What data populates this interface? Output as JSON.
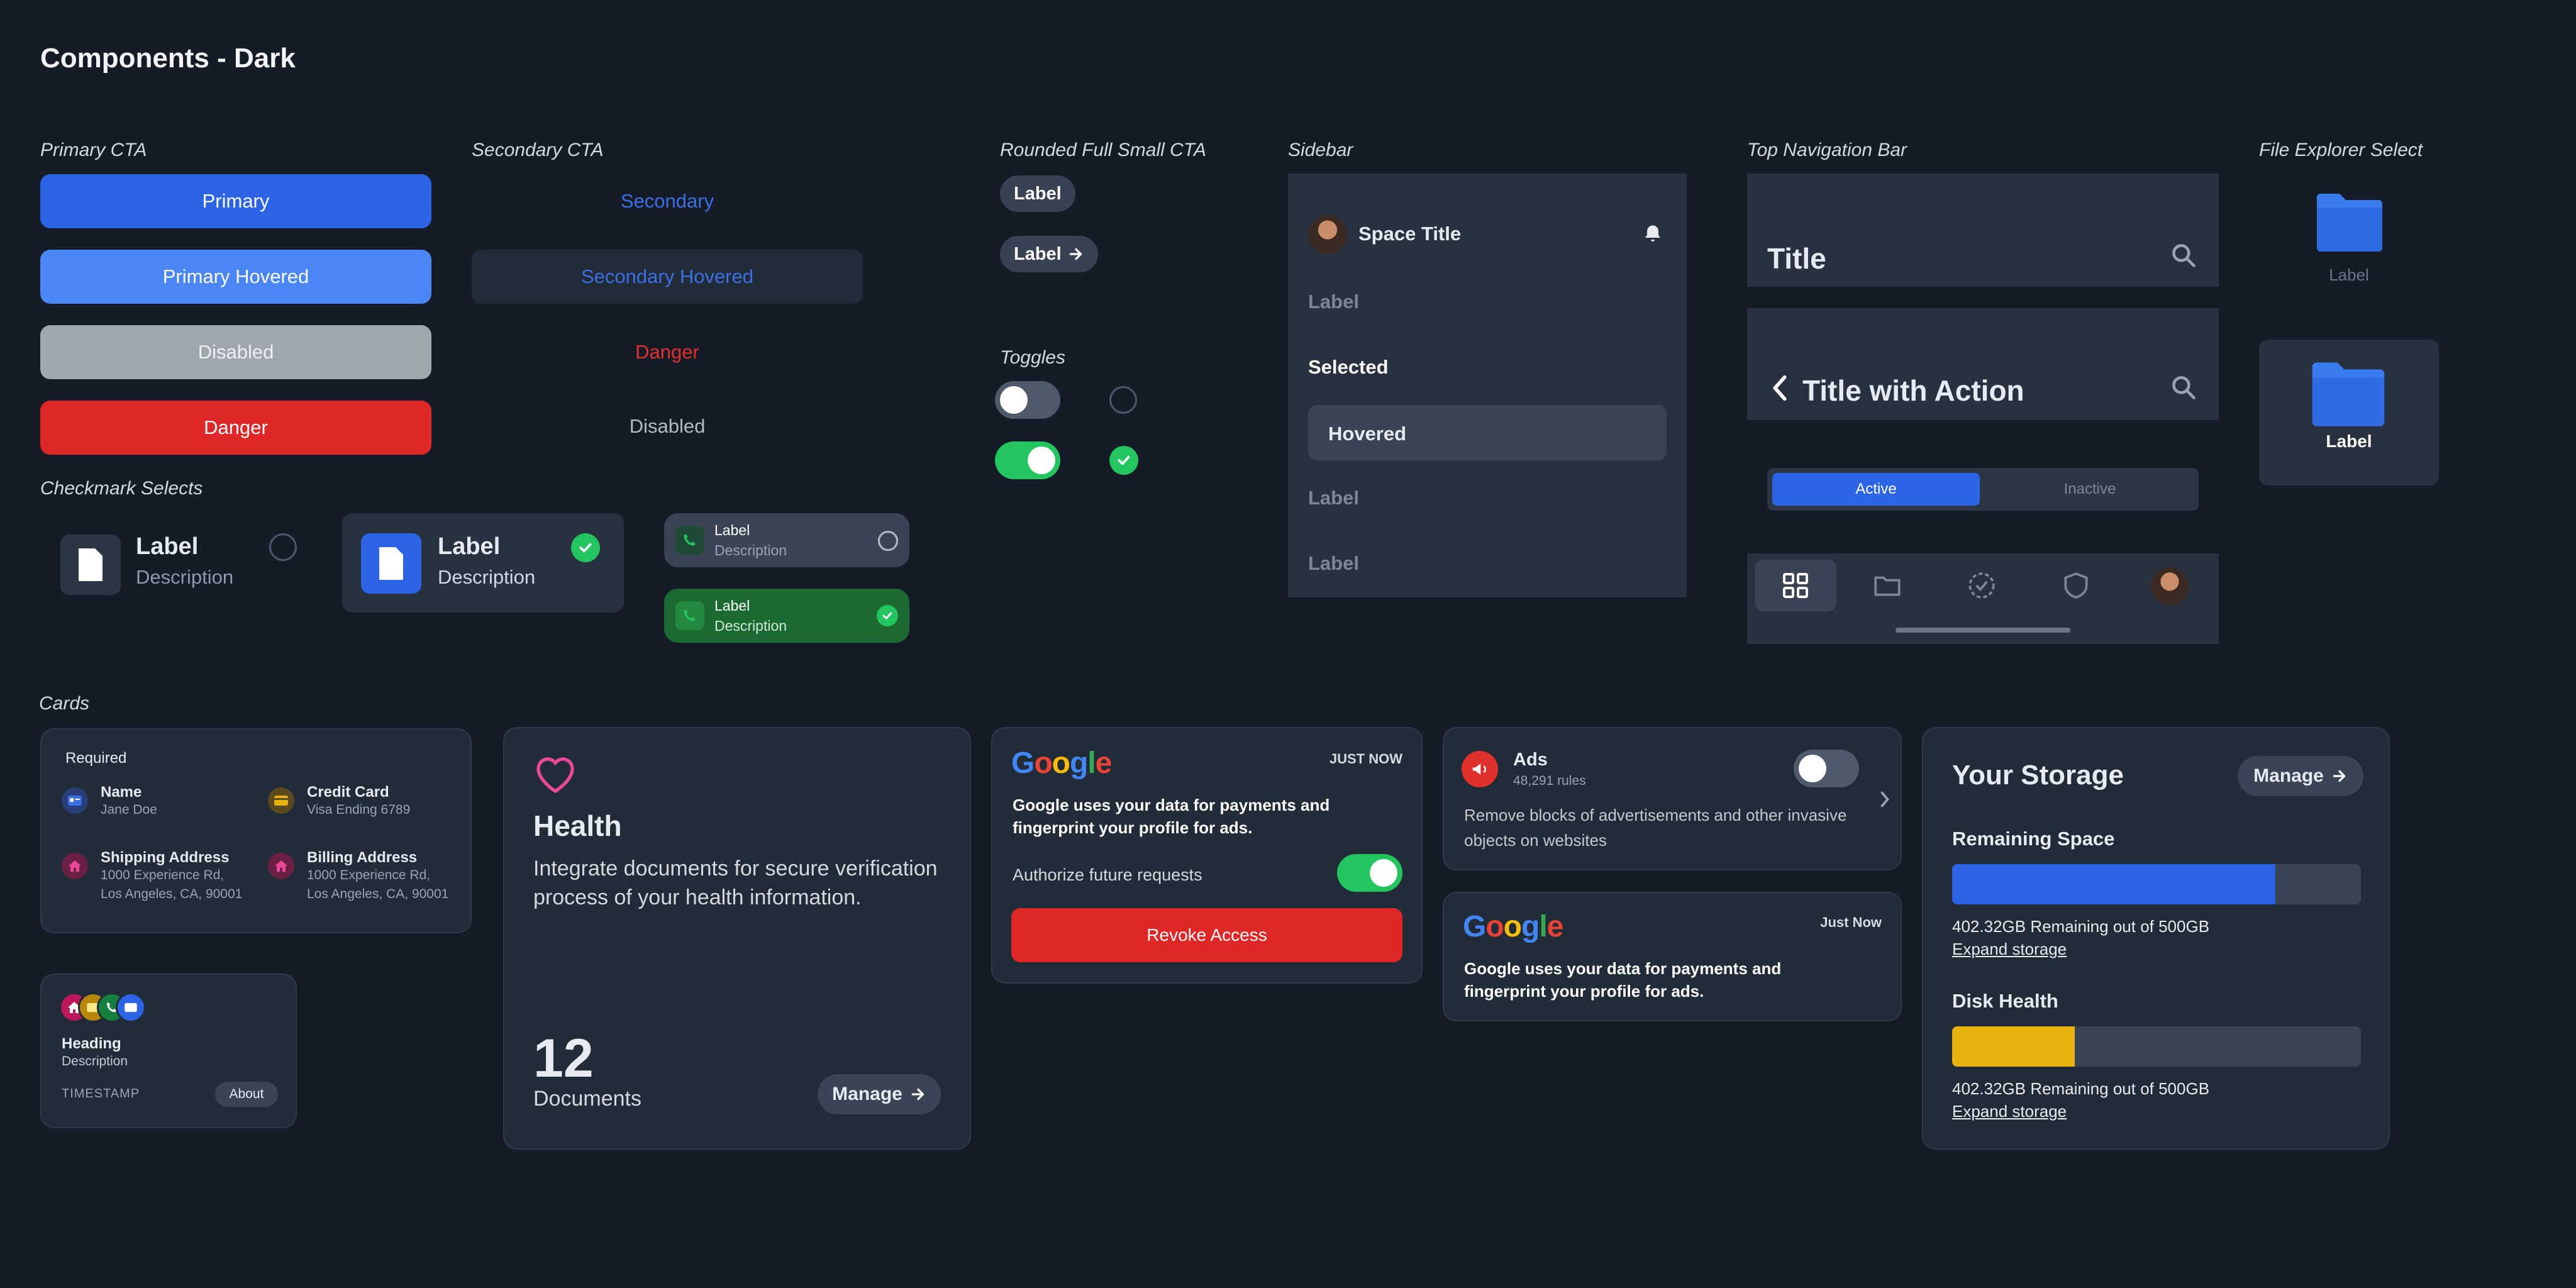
{
  "page_title": "Components - Dark",
  "sections": {
    "primary_cta": "Primary CTA",
    "secondary_cta": "Secondary CTA",
    "rounded_cta": "Rounded Full Small CTA",
    "sidebar": "Sidebar",
    "topnav": "Top Navigation Bar",
    "file_explorer": "File Explorer Select",
    "toggles": "Toggles",
    "checkmark": "Checkmark Selects",
    "cards": "Cards"
  },
  "primary_buttons": {
    "primary": "Primary",
    "primary_hovered": "Primary Hovered",
    "disabled": "Disabled",
    "danger": "Danger"
  },
  "secondary_buttons": {
    "secondary": "Secondary",
    "secondary_hovered": "Secondary Hovered",
    "danger": "Danger",
    "disabled": "Disabled"
  },
  "rounded": {
    "label1": "Label",
    "label2": "Label"
  },
  "sidebar": {
    "space_title": "Space Title",
    "items": [
      "Label",
      "Selected",
      "Hovered",
      "Label",
      "Label"
    ]
  },
  "topnav": {
    "title": "Title",
    "title_action": "Title with Action",
    "seg_active": "Active",
    "seg_inactive": "Inactive"
  },
  "file_explorer": {
    "label1": "Label",
    "label2": "Label"
  },
  "checkmark": {
    "a_label": "Label",
    "a_desc": "Description",
    "b_label": "Label",
    "b_desc": "Description",
    "c_label": "Label",
    "c_desc": "Description",
    "d_label": "Label",
    "d_desc": "Description"
  },
  "card_required": {
    "heading": "Required",
    "name_title": "Name",
    "name_value": "Jane Doe",
    "cc_title": "Credit Card",
    "cc_value": "Visa Ending 6789",
    "ship_title": "Shipping Address",
    "ship_line1": "1000 Experience Rd,",
    "ship_line2": "Los Angeles, CA, 90001",
    "bill_title": "Billing Address",
    "bill_line1": "1000 Experience Rd,",
    "bill_line2": "Los Angeles, CA, 90001"
  },
  "card_small": {
    "heading": "Heading",
    "description": "Description",
    "timestamp": "TIMESTAMP",
    "about": "About"
  },
  "card_health": {
    "title": "Health",
    "text": "Integrate documents for secure verification process of your health information.",
    "count": "12",
    "count_label": "Documents",
    "manage": "Manage"
  },
  "card_google1": {
    "brand": "Google",
    "time": "JUST NOW",
    "text_bold": "Google uses your data for",
    "text_rest": " payments and fingerprint your profile for ads.",
    "authorize": "Authorize future requests",
    "revoke": "Revoke Access"
  },
  "card_ads": {
    "title": "Ads",
    "rules": "48,291 rules",
    "text": "Remove blocks of advertisements and other invasive objects on websites"
  },
  "card_google2": {
    "brand": "Google",
    "time": "Just Now",
    "text_bold": "Google uses your data for",
    "text_rest": " payments and fingerprint your profile for ads."
  },
  "card_storage": {
    "title": "Your Storage",
    "manage": "Manage",
    "remaining_title": "Remaining Space",
    "remaining_text": "402.32GB Remaining out of 500GB",
    "remaining_link": "Expand storage",
    "remaining_fill": 0.79,
    "health_title": "Disk Health",
    "health_text": "402.32GB Remaining out of 500GB",
    "health_link": "Expand storage",
    "health_fill": 0.3
  },
  "colors": {
    "primary": "#2c64e8",
    "danger": "#e02728",
    "success": "#22c55e",
    "warning": "#e8b10b",
    "background": "#151c28",
    "surface": "#222b38"
  }
}
